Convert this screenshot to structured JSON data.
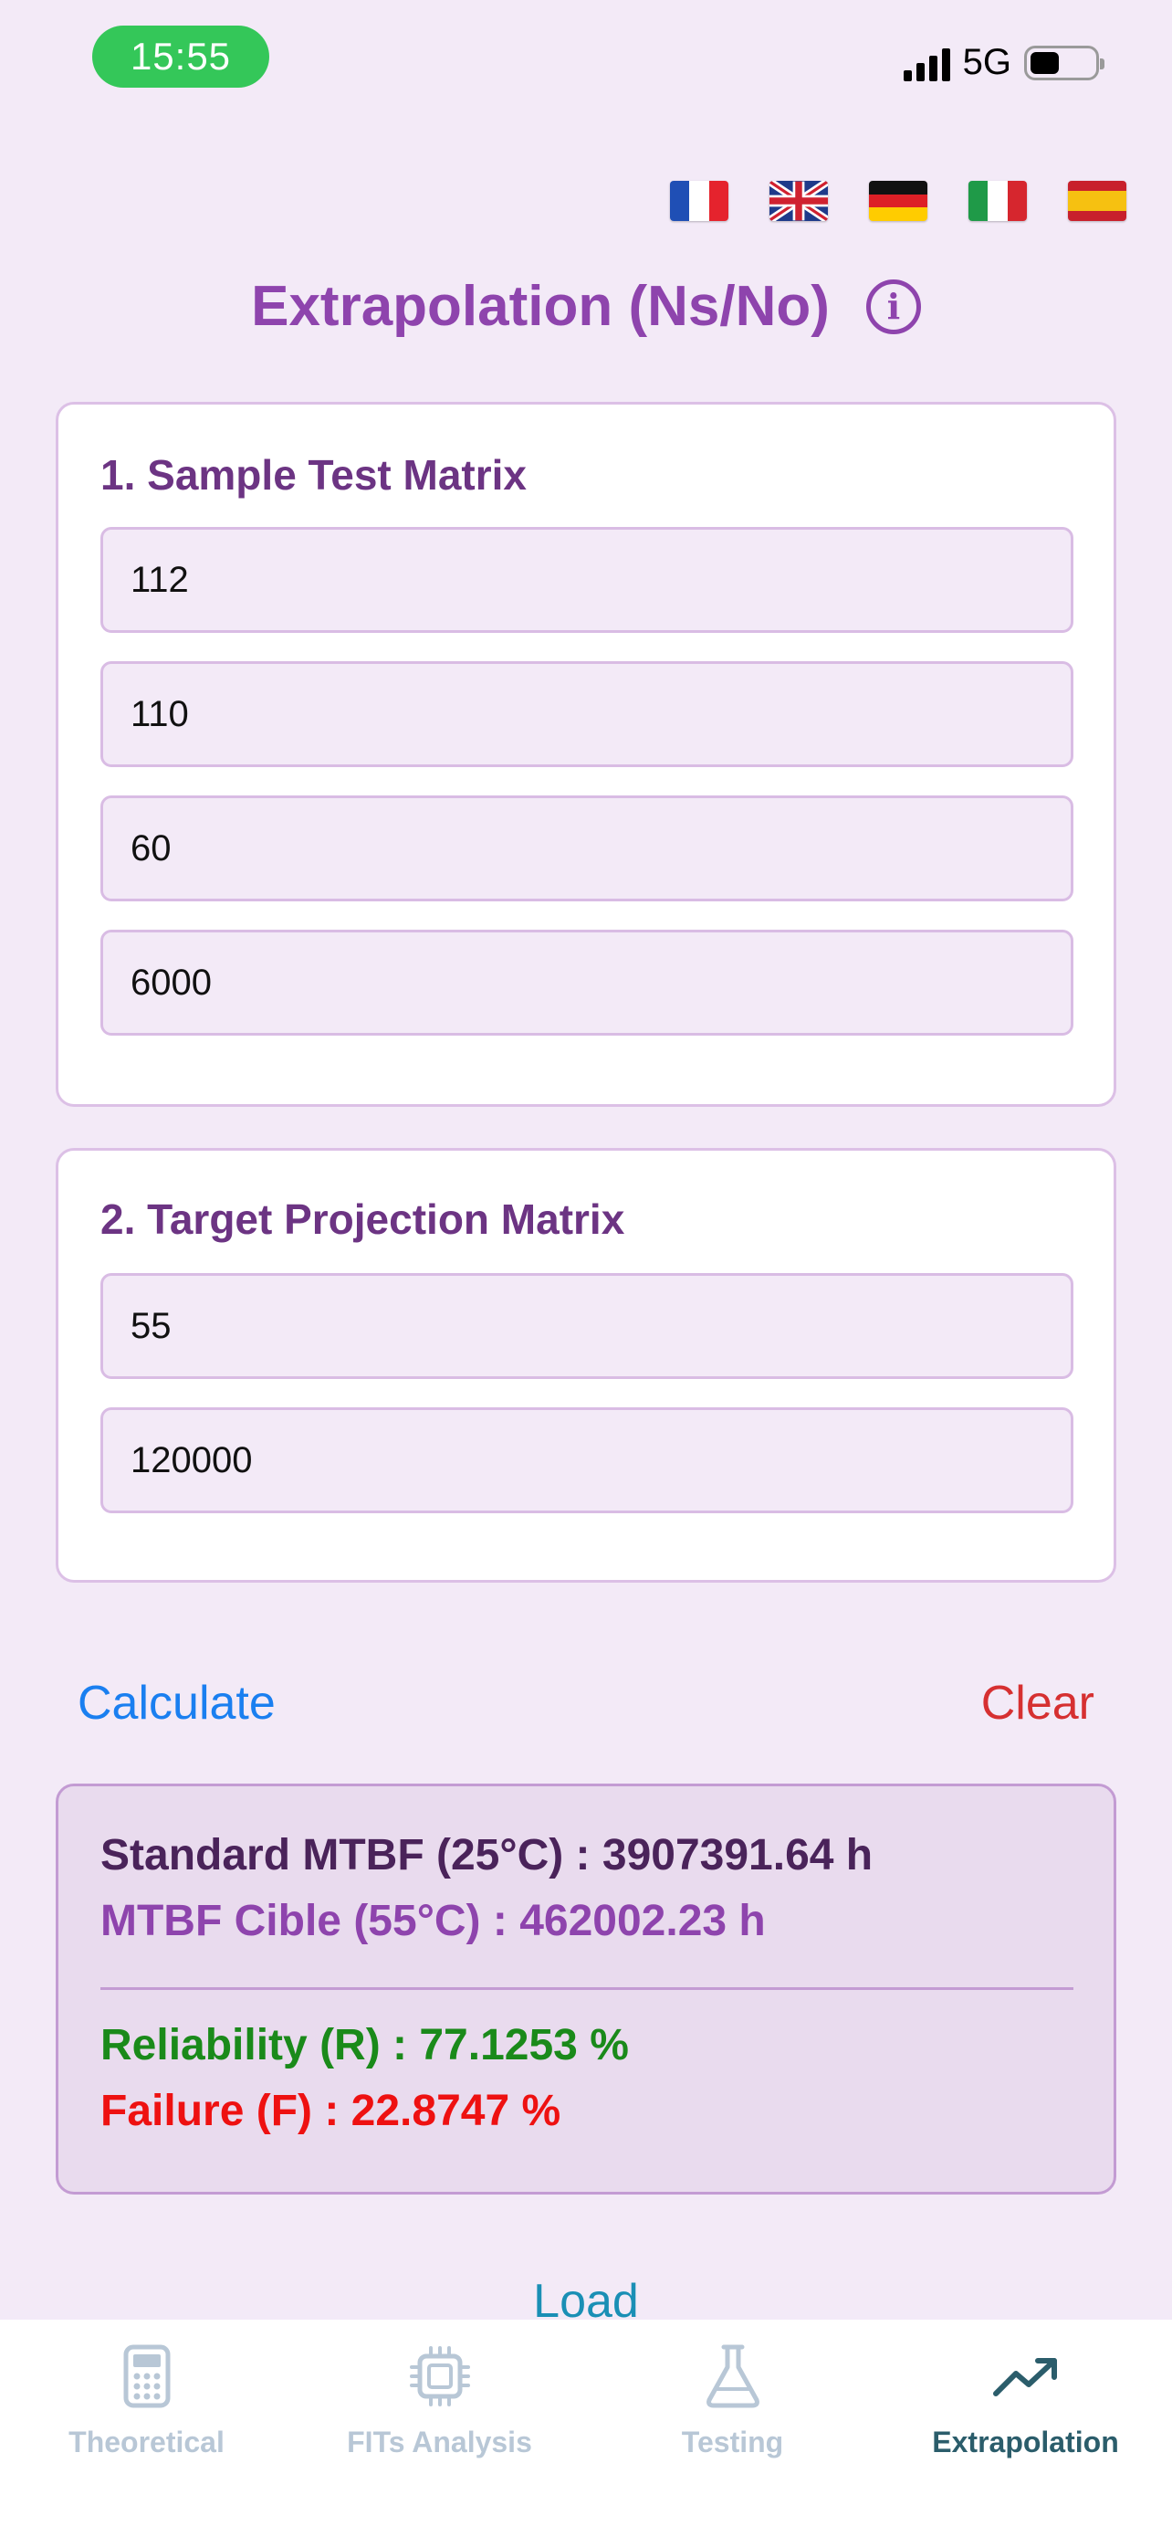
{
  "status_bar": {
    "time": "15:55",
    "network": "5G",
    "battery_level": 0.45
  },
  "languages": [
    "fr",
    "en",
    "de",
    "it",
    "es"
  ],
  "header": {
    "title": "Extrapolation (Ns/No)",
    "info_icon": "info-icon"
  },
  "sample_matrix": {
    "title": "1. Sample Test Matrix",
    "fields": [
      "112",
      "110",
      "60",
      "6000"
    ]
  },
  "target_matrix": {
    "title": "2. Target Projection Matrix",
    "fields": [
      "55",
      "120000"
    ]
  },
  "actions": {
    "calculate": "Calculate",
    "clear": "Clear",
    "load": "Load"
  },
  "results": {
    "standard_mtbf": "Standard MTBF (25°C) : 3907391.64 h",
    "target_mtbf": "MTBF Cible (55°C) : 462002.23 h",
    "reliability": "Reliability (R) : 77.1253 %",
    "failure": "Failure (F) : 22.8747 %"
  },
  "tabs": [
    {
      "label": "Theoretical",
      "icon": "calculator-icon",
      "active": false
    },
    {
      "label": "FITs Analysis",
      "icon": "chip-icon",
      "active": false
    },
    {
      "label": "Testing",
      "icon": "flask-icon",
      "active": false
    },
    {
      "label": "Extrapolation",
      "icon": "trend-up-icon",
      "active": true
    }
  ],
  "colors": {
    "background": "#f3eaf7",
    "accent": "#8e44ad",
    "section_title": "#6c3483",
    "calculate": "#1a7ff0",
    "clear": "#d63031",
    "reliability": "#1a8a1a",
    "failure": "#ee1111",
    "active_tab": "#2b5d6b",
    "inactive_tab": "#b8c7d6"
  }
}
